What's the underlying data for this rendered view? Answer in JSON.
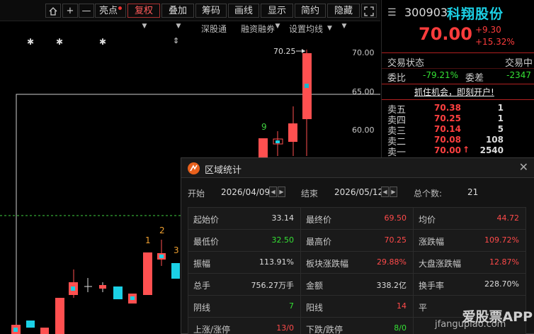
{
  "toolbar": {
    "home_icon": "home-icon",
    "plus": "+",
    "minus": "—",
    "highlight": "亮点",
    "adjust": "复权",
    "overlay": "叠加",
    "chips": "筹码",
    "drawline": "画线",
    "display": "显示",
    "simple": "简约",
    "hide": "隐藏"
  },
  "subtoolbar": {
    "shenguto": "深股通",
    "margin": "融资融券",
    "ma_settings": "设置均线"
  },
  "price_axis": [
    "70.00",
    "65.00",
    "60.00"
  ],
  "chart_labels": {
    "high_marker": "70.25",
    "star": "✱",
    "num9": "9",
    "num1": "1",
    "num2": "2",
    "num3": "3"
  },
  "stock": {
    "code": "300903",
    "name": "科翔股份",
    "price": "70.00",
    "change": "+9.30",
    "change_pct": "+15.32%",
    "status_label": "交易状态",
    "status_value": "交易中",
    "weibi_label": "委比",
    "weibi_value": "-79.21%",
    "weicha_label": "委差",
    "weicha_value": "-2347",
    "promo": "抓住机会，即刻开户!"
  },
  "orderbook": [
    {
      "label": "卖五",
      "price": "70.38",
      "vol": "1"
    },
    {
      "label": "卖四",
      "price": "70.25",
      "vol": "1"
    },
    {
      "label": "卖三",
      "price": "70.14",
      "vol": "5"
    },
    {
      "label": "卖二",
      "price": "70.08",
      "vol": "108"
    },
    {
      "label": "卖一",
      "price": "70.00",
      "vol": "2540"
    }
  ],
  "dialog": {
    "title": "区域统计",
    "start_label": "开始",
    "start_date": "2026/04/09",
    "end_label": "结束",
    "end_date": "2026/05/12",
    "count_label": "总个数:",
    "count_value": "21",
    "cells": [
      {
        "label": "起始价",
        "value": "33.14",
        "color": "white"
      },
      {
        "label": "最终价",
        "value": "69.50",
        "color": "red"
      },
      {
        "label": "均价",
        "value": "44.72",
        "color": "red"
      },
      {
        "label": "最低价",
        "value": "32.50",
        "color": "green"
      },
      {
        "label": "最高价",
        "value": "70.25",
        "color": "red"
      },
      {
        "label": "涨跌幅",
        "value": "109.72%",
        "color": "red"
      },
      {
        "label": "振幅",
        "value": "113.91%",
        "color": "white"
      },
      {
        "label": "板块涨跌幅",
        "value": "29.88%",
        "color": "red"
      },
      {
        "label": "大盘涨跌幅",
        "value": "12.87%",
        "color": "red"
      },
      {
        "label": "总手",
        "value": "756.27万手",
        "color": "white"
      },
      {
        "label": "金额",
        "value": "338.2亿",
        "color": "white"
      },
      {
        "label": "换手率",
        "value": "228.70%",
        "color": "white"
      },
      {
        "label": "阴线",
        "value": "7",
        "color": "green"
      },
      {
        "label": "阳线",
        "value": "14",
        "color": "red"
      },
      {
        "label": "平",
        "value": "",
        "color": "white"
      },
      {
        "label": "上涨/涨停",
        "value": "13/0",
        "color": "red"
      },
      {
        "label": "下跌/跌停",
        "value": "8/0",
        "color": "green"
      },
      {
        "label": "",
        "value": "",
        "color": "white"
      }
    ]
  },
  "watermark": {
    "brand": "爱股票APP",
    "site": "jfangupiao.com"
  }
}
